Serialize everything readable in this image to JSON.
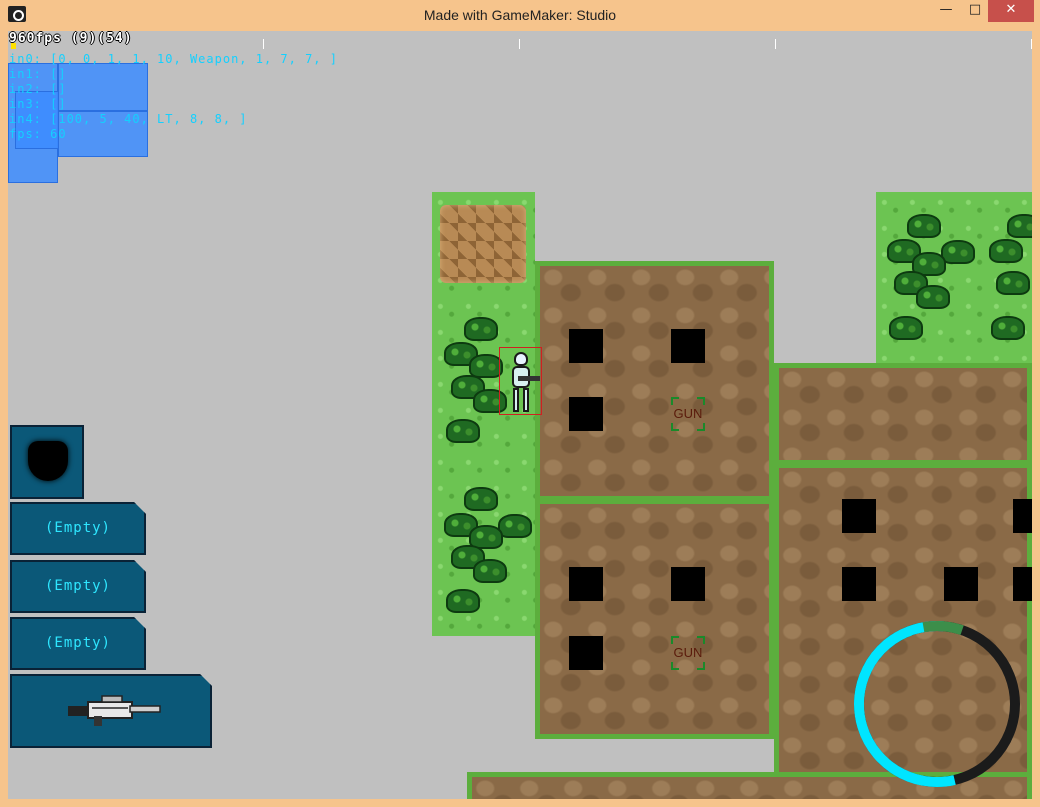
{
  "window": {
    "title": "Made with GameMaker: Studio",
    "minimize_glyph": "—",
    "maximize_glyph": "□",
    "close_glyph": "✕"
  },
  "debug": {
    "fps_line": "960fps (9)(54)",
    "lines": [
      "in0: [0, 0, 1, 1, 10, Weapon, 1, 7, 7, ]",
      "in1: []",
      "in2: []",
      "in3: []",
      "in4: [100, 5, 40, LT, 8, 8, ]",
      "fps: 60"
    ]
  },
  "pickups": {
    "gun_1": "GUN",
    "gun_2": "GUN"
  },
  "inventory": {
    "armor_slot": "armor-icon",
    "slot_1": "(Empty)",
    "slot_2": "(Empty)",
    "slot_3": "(Empty)",
    "weapon_slot": "rifle-icon"
  },
  "ring": {
    "cyan_fraction": 0.55,
    "colors": {
      "cyan": "#00e5ff",
      "dark": "#1b1b1b",
      "green": "#3c8e4a"
    }
  },
  "colors": {
    "titlebar": "#f6c48c",
    "background": "#c0c0c0",
    "grass": "#6cc452",
    "dirt": "#8a6a47",
    "hud_slot": "#0b5878",
    "hud_text": "#2ee6ff"
  }
}
